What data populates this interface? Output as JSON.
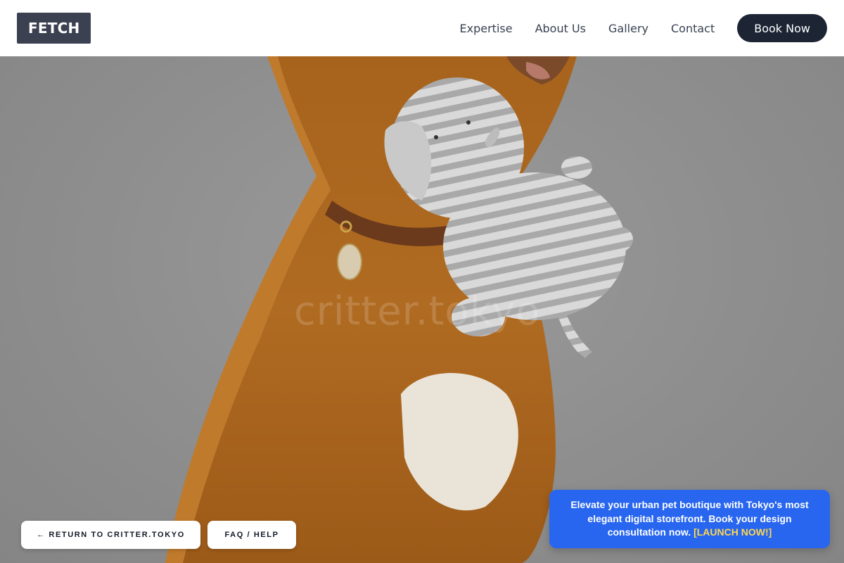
{
  "header": {
    "logo": "FETCH",
    "nav": [
      "Expertise",
      "About Us",
      "Gallery",
      "Contact"
    ],
    "cta": "Book Now"
  },
  "hero": {
    "watermark": "critter.tokyo",
    "image_alt": "golden retriever holding a striped plush elephant toy"
  },
  "footer_buttons": {
    "back": "← RETURN TO CRITTER.TOKYO",
    "faq": "FAQ / HELP"
  },
  "promo": {
    "text": "Elevate your urban pet boutique with Tokyo's most elegant digital storefront. Book your design consultation now.",
    "link": "[LAUNCH NOW!]"
  },
  "colors": {
    "logo_bg": "#3b4150",
    "cta_bg": "#1d2535",
    "promo_bg": "#2866f0",
    "promo_link": "#ffd84d",
    "hero_bg": "#8f8f8f"
  }
}
